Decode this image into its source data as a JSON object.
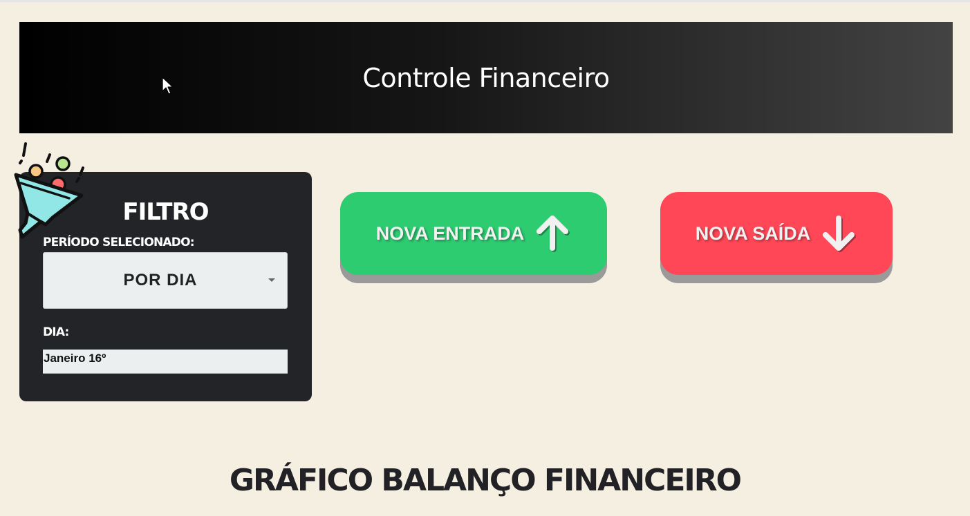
{
  "header": {
    "title": "Controle Financeiro"
  },
  "filter": {
    "title": "FILTRO",
    "period_label": "PERÍODO SELECIONADO:",
    "period_selected": "POR DIA",
    "day_label": "DIA:",
    "day_value": "Janeiro 16º"
  },
  "actions": {
    "new_income_label": "NOVA ENTRADA",
    "new_expense_label": "NOVA SAÍDA"
  },
  "chart_section": {
    "title": "GRÁFICO BALANÇO FINANCEIRO"
  },
  "icons": {
    "funnel": "funnel-icon",
    "arrow_up": "arrow-up-icon",
    "arrow_down": "arrow-down-icon",
    "cursor": "cursor-icon",
    "caret": "chevron-down-icon"
  },
  "colors": {
    "background": "#f5efe2",
    "income": "#2ecc71",
    "expense": "#ff4757",
    "card": "#232427"
  }
}
